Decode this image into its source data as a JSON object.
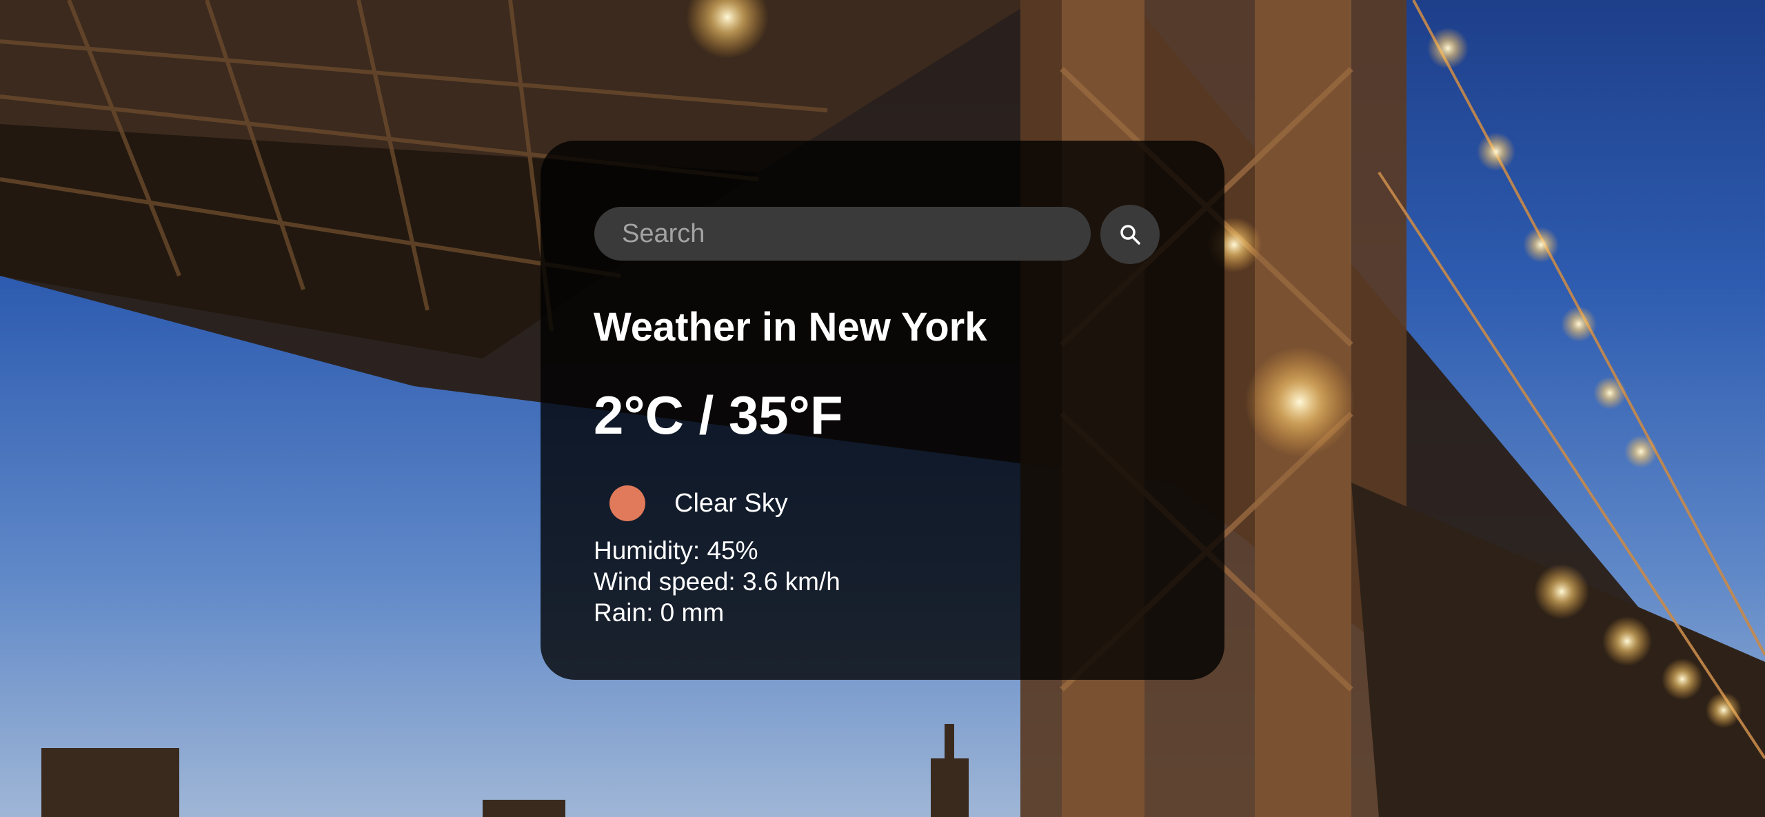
{
  "search": {
    "placeholder": "Search",
    "value": ""
  },
  "search_button_icon": "search-icon",
  "weather": {
    "title": "Weather in New York",
    "temperature": "2°C / 35°F",
    "condition": "Clear Sky",
    "condition_icon": "clear-sky-icon",
    "condition_icon_color": "#e07a5a",
    "humidity": "Humidity: 45%",
    "wind": "Wind speed: 3.6 km/h",
    "rain": "Rain: 0 mm"
  },
  "colors": {
    "card_background": "rgba(0,0,0,0.78)",
    "input_background": "#3a3a3a",
    "text": "#ffffff",
    "placeholder": "#a3a3a3"
  }
}
